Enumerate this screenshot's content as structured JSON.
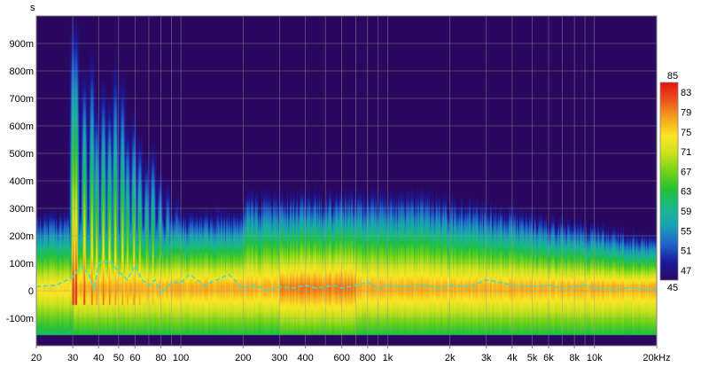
{
  "chart_data": {
    "type": "heatmap",
    "title": "",
    "ylabel": "s",
    "xlabel_unit": "kHz",
    "x_scale": "log",
    "xlim": [
      20,
      20000
    ],
    "ylim": [
      -0.2,
      1.0
    ],
    "grid": true,
    "x_ticks": [
      {
        "value": 20,
        "label": "20"
      },
      {
        "value": 30,
        "label": "30"
      },
      {
        "value": 40,
        "label": "40"
      },
      {
        "value": 50,
        "label": "50"
      },
      {
        "value": 60,
        "label": "60"
      },
      {
        "value": 80,
        "label": "80"
      },
      {
        "value": 100,
        "label": "100"
      },
      {
        "value": 200,
        "label": "200"
      },
      {
        "value": 300,
        "label": "300"
      },
      {
        "value": 400,
        "label": "400"
      },
      {
        "value": 600,
        "label": "600"
      },
      {
        "value": 800,
        "label": "800"
      },
      {
        "value": 1000,
        "label": "1k"
      },
      {
        "value": 2000,
        "label": "2k"
      },
      {
        "value": 3000,
        "label": "3k"
      },
      {
        "value": 4000,
        "label": "4k"
      },
      {
        "value": 5000,
        "label": "5k"
      },
      {
        "value": 6000,
        "label": "6k"
      },
      {
        "value": 8000,
        "label": "8k"
      },
      {
        "value": 10000,
        "label": "10k"
      },
      {
        "value": 20000,
        "label": "20kHz"
      }
    ],
    "y_ticks": [
      {
        "value": -0.1,
        "label": "-100m"
      },
      {
        "value": 0,
        "label": "0"
      },
      {
        "value": 0.1,
        "label": "100m"
      },
      {
        "value": 0.2,
        "label": "200m"
      },
      {
        "value": 0.3,
        "label": "300m"
      },
      {
        "value": 0.4,
        "label": "400m"
      },
      {
        "value": 0.5,
        "label": "500m"
      },
      {
        "value": 0.6,
        "label": "600m"
      },
      {
        "value": 0.7,
        "label": "700m"
      },
      {
        "value": 0.8,
        "label": "800m"
      },
      {
        "value": 0.9,
        "label": "900m"
      }
    ],
    "colorbar": {
      "range": [
        45,
        85
      ],
      "ticks": [
        85,
        83,
        79,
        75,
        71,
        67,
        63,
        59,
        55,
        51,
        47,
        45
      ],
      "colors": [
        "#2a0860",
        "#1a1a9a",
        "#1f64c8",
        "#1aa0b4",
        "#19b88c",
        "#22c03a",
        "#6ed219",
        "#c8e11e",
        "#fae626",
        "#f5a51e",
        "#eb5319",
        "#e11414"
      ]
    },
    "series": [
      {
        "style": "dashed",
        "color": "#40e0d0",
        "x": [
          20,
          25,
          30,
          33,
          36,
          38,
          40,
          45,
          50,
          55,
          60,
          65,
          70,
          75,
          80,
          90,
          100,
          110,
          130,
          150,
          170,
          200,
          230,
          260,
          300,
          350,
          400,
          450,
          500,
          550,
          600,
          700,
          800,
          900,
          1000,
          1200,
          1500,
          1800,
          2000,
          2500,
          3000,
          3500,
          4000,
          5000,
          6000,
          7000,
          8000,
          9000,
          10000,
          12000,
          15000,
          18000,
          20000
        ],
        "y": [
          0.015,
          0.02,
          0.05,
          0.09,
          0.06,
          0.0,
          0.1,
          0.11,
          0.07,
          0.04,
          0.09,
          0.04,
          0.02,
          0.04,
          -0.01,
          0.03,
          0.03,
          0.06,
          0.02,
          0.04,
          0.06,
          0.01,
          0.02,
          0.0,
          0.015,
          0.01,
          0.02,
          0.01,
          0.015,
          0.02,
          0.01,
          0.02,
          0.03,
          0.01,
          0.02,
          0.015,
          0.02,
          0.01,
          0.02,
          0.015,
          0.04,
          0.03,
          0.02,
          0.015,
          0.02,
          0.01,
          0.015,
          0.02,
          0.01,
          0.005,
          0.01,
          0.005,
          0.005
        ]
      }
    ],
    "peaks": [
      {
        "f": 30,
        "t": 1.0,
        "i": 1.0
      },
      {
        "f": 31,
        "t": 1.0,
        "i": 1.0
      },
      {
        "f": 34,
        "t": 0.82,
        "i": 0.95
      },
      {
        "f": 37,
        "t": 0.88,
        "i": 0.9
      },
      {
        "f": 39,
        "t": 0.7,
        "i": 0.85
      },
      {
        "f": 42,
        "t": 0.78,
        "i": 0.9
      },
      {
        "f": 45,
        "t": 0.72,
        "i": 0.88
      },
      {
        "f": 48,
        "t": 0.85,
        "i": 0.85
      },
      {
        "f": 52,
        "t": 0.8,
        "i": 0.85
      },
      {
        "f": 55,
        "t": 0.62,
        "i": 0.82
      },
      {
        "f": 59,
        "t": 0.66,
        "i": 0.85
      },
      {
        "f": 63,
        "t": 0.58,
        "i": 0.82
      },
      {
        "f": 68,
        "t": 0.5,
        "i": 0.78
      },
      {
        "f": 73,
        "t": 0.55,
        "i": 0.8
      },
      {
        "f": 79,
        "t": 0.45,
        "i": 0.75
      },
      {
        "f": 86,
        "t": 0.4,
        "i": 0.72
      },
      {
        "f": 95,
        "t": 0.35,
        "i": 0.7
      },
      {
        "f": 110,
        "t": 0.3,
        "i": 0.66
      },
      {
        "f": 125,
        "t": 0.28,
        "i": 0.64
      },
      {
        "f": 150,
        "t": 0.32,
        "i": 0.68
      },
      {
        "f": 180,
        "t": 0.28,
        "i": 0.6
      }
    ]
  }
}
